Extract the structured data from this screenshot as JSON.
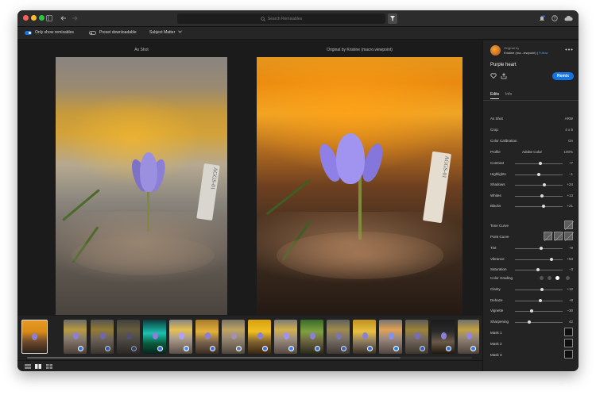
{
  "search": {
    "placeholder": "Search Remixables"
  },
  "toolbar": {
    "only_show_remixables": "Only show remixables",
    "preset_downloadable": "Preset downloadable",
    "subject_matter": "Subject Matter"
  },
  "compare": {
    "left_label": "As Shot",
    "right_label": "Original by Kristine (macro.viewpoint)"
  },
  "photo": {
    "tag_text_left": "AGGS-01",
    "tag_text_right": "AGGS-01"
  },
  "author": {
    "original_by": "Original by",
    "name": "Kristine (ma...iewpoint)",
    "separator": "|",
    "follow": "Follow"
  },
  "image_title": "Purple heart",
  "remix_label": "Remix",
  "tabs": [
    {
      "label": "Edits"
    },
    {
      "label": "Info"
    }
  ],
  "edits": {
    "as_shot": {
      "label": "As Shot",
      "value": "ARW"
    },
    "crop": {
      "label": "Crop",
      "value": "4 x 5"
    },
    "color_calibration": {
      "label": "Color Calibration",
      "value": "On"
    },
    "profile": {
      "label": "Profile",
      "profile_name": "Adobe Color",
      "value": "100%"
    },
    "sliders_a": [
      {
        "label": "Contrast",
        "value": "+7",
        "level": 0.54
      },
      {
        "label": "Highlights",
        "value": "−1",
        "level": 0.5
      },
      {
        "label": "Shadows",
        "value": "+24",
        "level": 0.62
      },
      {
        "label": "Whites",
        "value": "+13",
        "level": 0.57
      },
      {
        "label": "Blacks",
        "value": "+21",
        "level": 0.6
      }
    ],
    "tone_curve": {
      "label": "Tone Curve"
    },
    "point_curve": {
      "label": "Point Curve"
    },
    "sliders_b": [
      {
        "label": "Tint",
        "value": "+9",
        "level": 0.55
      },
      {
        "label": "Vibrance",
        "value": "+53",
        "level": 0.76
      },
      {
        "label": "Saturation",
        "value": "−3",
        "level": 0.49
      }
    ],
    "color_grading": {
      "label": "Color Grading"
    },
    "sliders_c": [
      {
        "label": "Clarity",
        "value": "+12",
        "level": 0.56
      },
      {
        "label": "Dehaze",
        "value": "+8",
        "level": 0.54
      },
      {
        "label": "Vignette",
        "value": "−30",
        "level": 0.35
      },
      {
        "label": "Sharpening",
        "value": "42",
        "level": 0.3
      }
    ],
    "masks": [
      {
        "label": "Mask 1"
      },
      {
        "label": "Mask 2"
      },
      {
        "label": "Mask 3"
      }
    ]
  },
  "colors": {
    "accent": "#1473e6",
    "window_bg": "#1e1e1e",
    "panel_bg": "#232323"
  },
  "icons": [
    "sidebar-toggle-icon",
    "back-arrow-icon",
    "forward-arrow-icon",
    "search-icon",
    "filter-icon",
    "notification-bell-icon",
    "help-icon",
    "cloud-icon",
    "heart-icon",
    "share-icon",
    "more-options-icon",
    "chevron-down-icon",
    "grid-view-icon",
    "compare-view-icon",
    "single-view-icon"
  ]
}
